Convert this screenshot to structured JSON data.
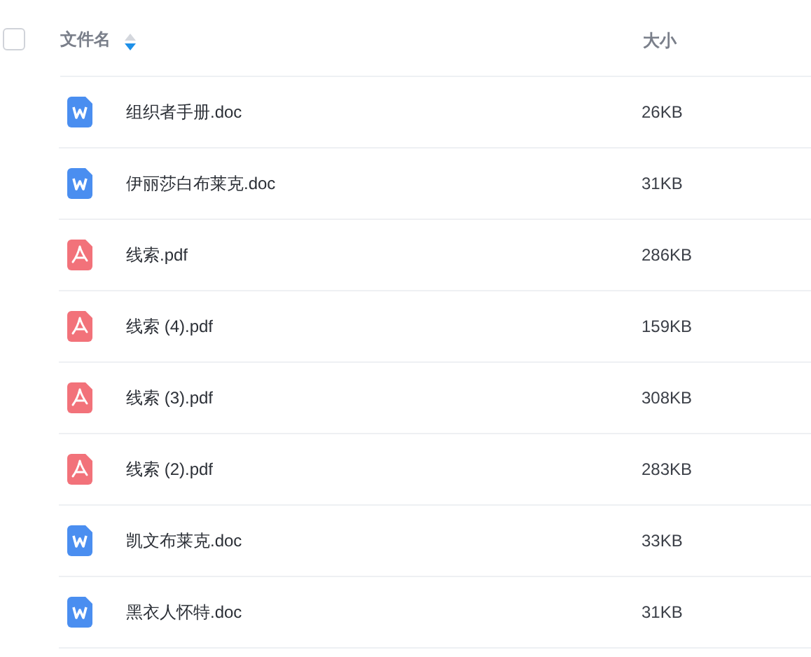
{
  "header": {
    "checked": false,
    "columns": [
      {
        "label": "文件名",
        "sort_descending": true
      },
      {
        "label": "大小"
      }
    ]
  },
  "rows": [
    {
      "kind": "doc",
      "name": "组织者手册.doc",
      "size": "26KB"
    },
    {
      "kind": "doc",
      "name": "伊丽莎白布莱克.doc",
      "size": "31KB"
    },
    {
      "kind": "pdf",
      "name": "线索.pdf",
      "size": "286KB"
    },
    {
      "kind": "pdf",
      "name": "线索 (4).pdf",
      "size": "159KB"
    },
    {
      "kind": "pdf",
      "name": "线索 (3).pdf",
      "size": "308KB"
    },
    {
      "kind": "pdf",
      "name": "线索 (2).pdf",
      "size": "283KB"
    },
    {
      "kind": "doc",
      "name": "凯文布莱克.doc",
      "size": "33KB"
    },
    {
      "kind": "doc",
      "name": "黑衣人怀特.doc",
      "size": "31KB"
    }
  ]
}
